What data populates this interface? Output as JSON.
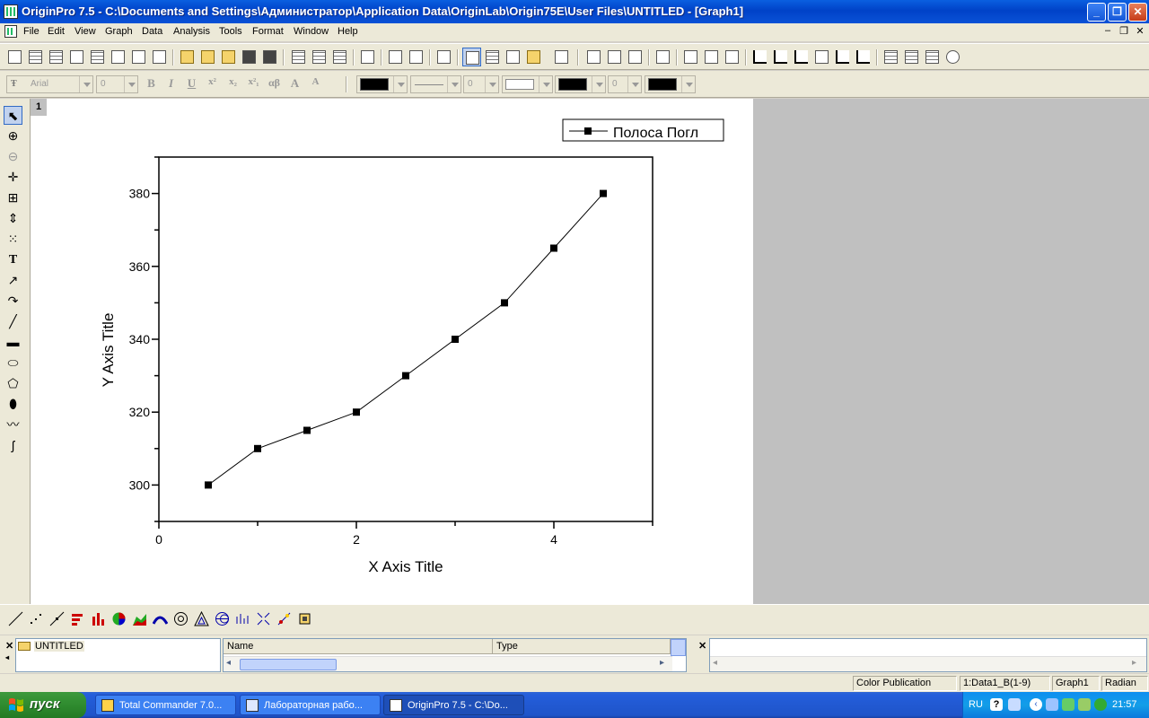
{
  "window": {
    "title": "OriginPro 7.5 - C:\\Documents and Settings\\Администратор\\Application Data\\OriginLab\\Origin75E\\User Files\\UNTITLED - [Graph1]"
  },
  "menu": [
    "File",
    "Edit",
    "View",
    "Graph",
    "Data",
    "Analysis",
    "Tools",
    "Format",
    "Window",
    "Help"
  ],
  "format_toolbar": {
    "font": "Arial",
    "font_size": "0",
    "line_width": "0",
    "pattern_size": "0"
  },
  "graph": {
    "layer": "1",
    "legend": "Полоса Погл",
    "xlabel": "X Axis Title",
    "ylabel": "Y Axis Title"
  },
  "chart_data": {
    "type": "line",
    "series": [
      {
        "name": "Полоса Погл",
        "marker": "square",
        "x": [
          0.5,
          1.0,
          1.5,
          2.0,
          2.5,
          3.0,
          3.5,
          4.0,
          4.5
        ],
        "y": [
          300,
          310,
          315,
          320,
          330,
          340,
          350,
          365,
          380
        ]
      }
    ],
    "xlabel": "X Axis Title",
    "ylabel": "Y Axis Title",
    "xlim": [
      0,
      5
    ],
    "ylim": [
      290,
      390
    ],
    "xticks": [
      0,
      2,
      4
    ],
    "yticks": [
      300,
      320,
      340,
      360,
      380
    ],
    "legend_position": "top-right",
    "grid": false
  },
  "explorer": {
    "folder": "UNTITLED",
    "columns": [
      "Name",
      "Type"
    ]
  },
  "status": {
    "theme": "Color Publication",
    "data": "1:Data1_B(1-9)",
    "window": "Graph1",
    "angle": "Radian"
  },
  "taskbar": {
    "start": "пуск",
    "tasks": [
      "Total Commander 7.0...",
      "Лабораторная рабо...",
      "OriginPro 7.5 - C:\\Do..."
    ],
    "lang": "RU",
    "time": "21:57"
  }
}
